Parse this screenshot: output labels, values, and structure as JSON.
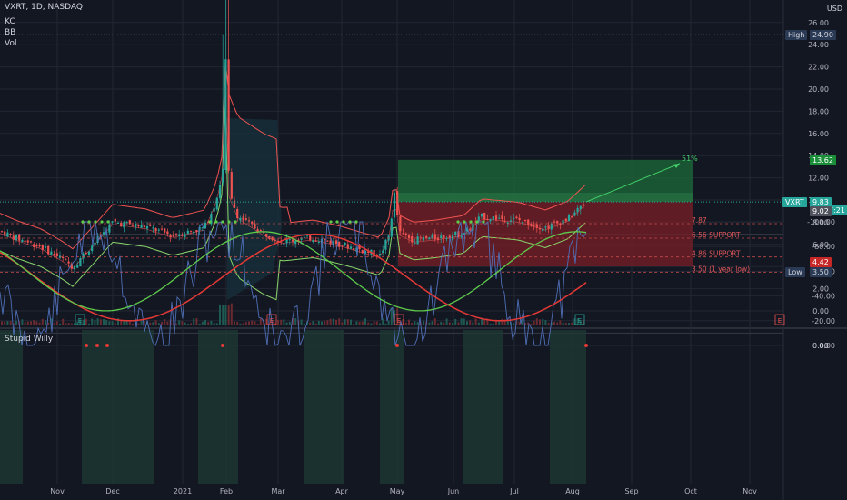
{
  "symbol_line": "VXRT, 1D, NASDAQ",
  "indicators": [
    "KC",
    "BB",
    "Vol"
  ],
  "currency": "USD",
  "colors": {
    "bg": "#131722",
    "grid": "#232733",
    "candle_up": "#26a69a",
    "candle_down": "#ef5350",
    "profit": "#1e6b3a",
    "loss": "#7a1f26",
    "keltner": "#ef5350",
    "bollinger_lower": "#8bd66b",
    "osc_line": "#4f6fb8",
    "signal_red": "#e53935",
    "signal_green": "#5ecb4a"
  },
  "chart_data": [
    {
      "type": "candlestick",
      "ylim": [
        -0.4,
        26.3
      ],
      "y_ticks": [
        "26.00",
        "24.00",
        "22.00",
        "20.00",
        "18.00",
        "16.00",
        "14.00",
        "12.00",
        "10.00",
        "8.00",
        "6.00",
        "4.00",
        "2.00",
        "0.00"
      ],
      "x_ticks": [
        "Nov",
        "Dec",
        "2021",
        "Feb",
        "Mar",
        "Apr",
        "May",
        "Jun",
        "Jul",
        "Aug",
        "Sep",
        "Oct",
        "Nov"
      ],
      "price_labels": [
        {
          "name": "High",
          "value": "24.90",
          "numeric": 24.9
        },
        {
          "name": "",
          "value": "13.62",
          "numeric": 13.62
        },
        {
          "name": "VXRT",
          "value": "9.83",
          "numeric": 9.83,
          "sub": "04:37:21"
        },
        {
          "name": "",
          "value": "9.02",
          "numeric": 9.02
        },
        {
          "name": "",
          "value": "4.42",
          "numeric": 4.42
        },
        {
          "name": "Low",
          "value": "3.50",
          "numeric": 3.5
        }
      ],
      "annotations": [
        {
          "text": "7.87",
          "numeric": 7.87
        },
        {
          "text": "6.56 SUPPORT",
          "numeric": 6.56
        },
        {
          "text": "4.86 SUPPORT",
          "numeric": 4.86
        },
        {
          "text": "3.50 (1 year low)",
          "numeric": 3.5
        }
      ],
      "support_lines": [
        7.87,
        6.56,
        4.86,
        3.5
      ],
      "projection": {
        "label": "51%",
        "entry": 9.83,
        "target": 13.62,
        "stop": 4.42
      },
      "earnings_markers": [
        "E",
        "E",
        "E",
        "E",
        "E"
      ],
      "description": "Daily candlesticks with Keltner channel and Bollinger bands; spike to 24.90 in early February 2021, consolidation between about 6.5 and 10 from May to August 2021."
    },
    {
      "type": "line",
      "title": "Stupid Willy",
      "ylim": [
        -105,
        3
      ],
      "y_ticks": [
        "0.00",
        "-20.00",
        "-40.00",
        "-60.00",
        "-80.00",
        "-100.00"
      ],
      "series_colors": [
        "#4f6fb8",
        "#5ecb4a",
        "#e53935"
      ]
    }
  ]
}
